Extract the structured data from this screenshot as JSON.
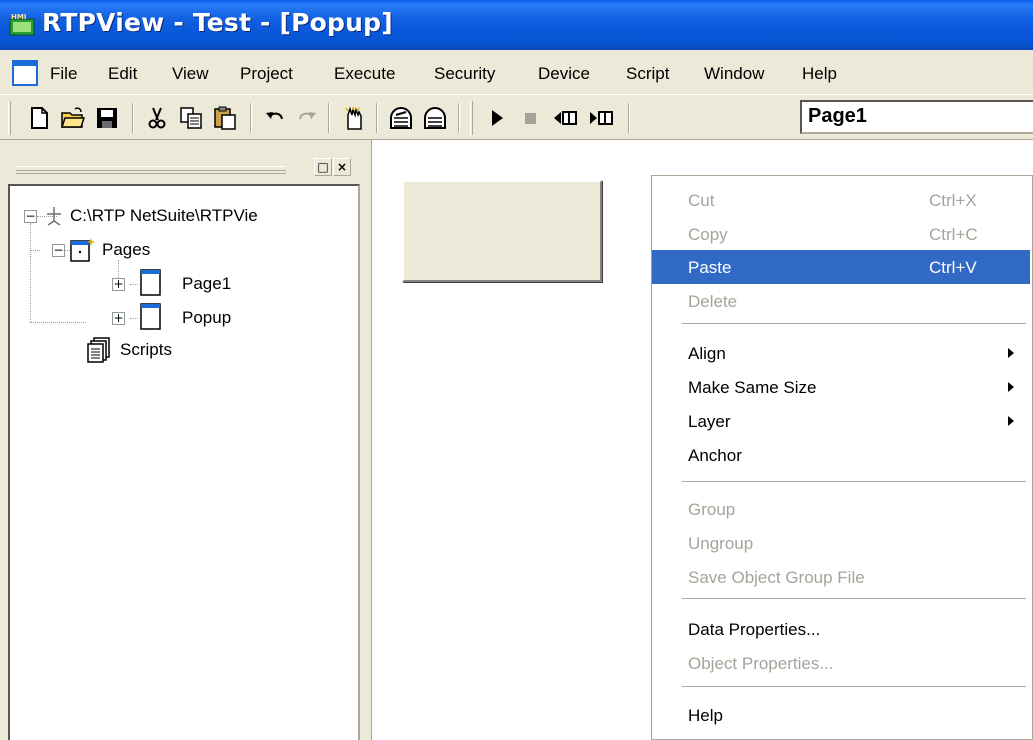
{
  "window": {
    "title": "RTPView  -  Test - [Popup]",
    "app_icon_text": "HMI"
  },
  "menubar": {
    "items": [
      "File",
      "Edit",
      "View",
      "Project",
      "Execute",
      "Security",
      "Device",
      "Script",
      "Window",
      "Help"
    ]
  },
  "toolbar": {
    "buttons": [
      "new-document-icon",
      "open-folder-icon",
      "save-icon",
      "cut-icon",
      "copy-icon",
      "paste-icon",
      "undo-icon",
      "redo-icon",
      "pointer-hand-icon",
      "front-layer-icon",
      "back-layer-icon",
      "play-icon",
      "stop-icon",
      "step-back-icon",
      "step-forward-icon"
    ],
    "page_selector": "Page1"
  },
  "tree": {
    "root": "C:\\RTP NetSuite\\RTPVie",
    "pages_label": "Pages",
    "pages": [
      "Page1",
      "Popup"
    ],
    "scripts_label": "Scripts"
  },
  "panel": {
    "restore_label": "□",
    "close_label": "×"
  },
  "context_menu": {
    "items": [
      {
        "label": "Cut",
        "shortcut": "Ctrl+X",
        "state": "disabled"
      },
      {
        "label": "Copy",
        "shortcut": "Ctrl+C",
        "state": "disabled"
      },
      {
        "label": "Paste",
        "shortcut": "Ctrl+V",
        "state": "selected"
      },
      {
        "label": "Delete",
        "shortcut": "",
        "state": "disabled"
      },
      {
        "label": "Align",
        "shortcut": "",
        "state": "enabled",
        "submenu": true
      },
      {
        "label": "Make Same Size",
        "shortcut": "",
        "state": "enabled",
        "submenu": true
      },
      {
        "label": "Layer",
        "shortcut": "",
        "state": "enabled",
        "submenu": true
      },
      {
        "label": "Anchor",
        "shortcut": "",
        "state": "enabled"
      },
      {
        "label": "Group",
        "shortcut": "",
        "state": "disabled"
      },
      {
        "label": "Ungroup",
        "shortcut": "",
        "state": "disabled"
      },
      {
        "label": "Save Object Group File",
        "shortcut": "",
        "state": "disabled"
      },
      {
        "label": "Data Properties...",
        "shortcut": "",
        "state": "enabled"
      },
      {
        "label": "Object Properties...",
        "shortcut": "",
        "state": "disabled"
      },
      {
        "label": "Help",
        "shortcut": "",
        "state": "enabled"
      }
    ]
  },
  "colors": {
    "selection": "#316ac5",
    "disabled_text": "#a7a39a",
    "titlebar": "#0753d4"
  }
}
